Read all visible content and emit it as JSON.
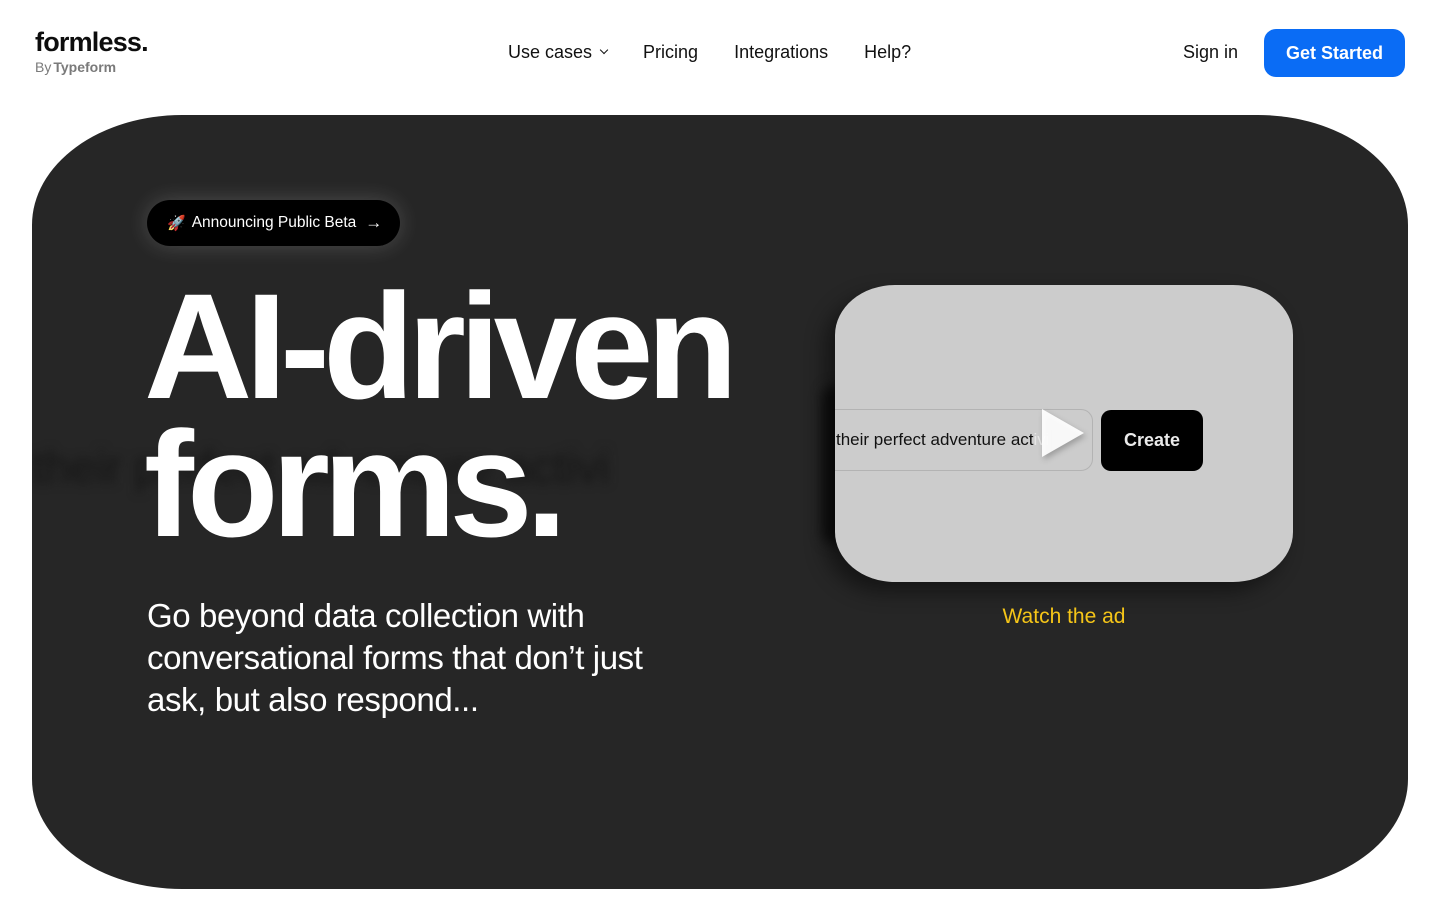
{
  "header": {
    "logo_word": "formless.",
    "logo_by": "By",
    "logo_brand": "Typeform",
    "nav": [
      {
        "label": "Use cases",
        "has_dropdown": true
      },
      {
        "label": "Pricing"
      },
      {
        "label": "Integrations"
      },
      {
        "label": "Help?"
      }
    ],
    "sign_in": "Sign in",
    "get_started": "Get Started"
  },
  "hero": {
    "badge_icon": "🚀",
    "badge_label": "Announcing Public Beta",
    "badge_arrow": "→",
    "headline_line1": "AI-driven",
    "headline_line2": "forms.",
    "subtext": "Go beyond data collection with conversational forms that don’t just ask, but also respond...",
    "video": {
      "input_text": "their perfect adventure act",
      "input_text_faded": "ivi",
      "create_label": "Create"
    },
    "watch_label": "Watch the ad",
    "ghost_text": "their perfect adventure activi"
  },
  "colors": {
    "primary_button": "#0a6cf5",
    "hero_bg": "#262626",
    "accent_link": "#f5c518",
    "video_bg": "#cccccc"
  }
}
